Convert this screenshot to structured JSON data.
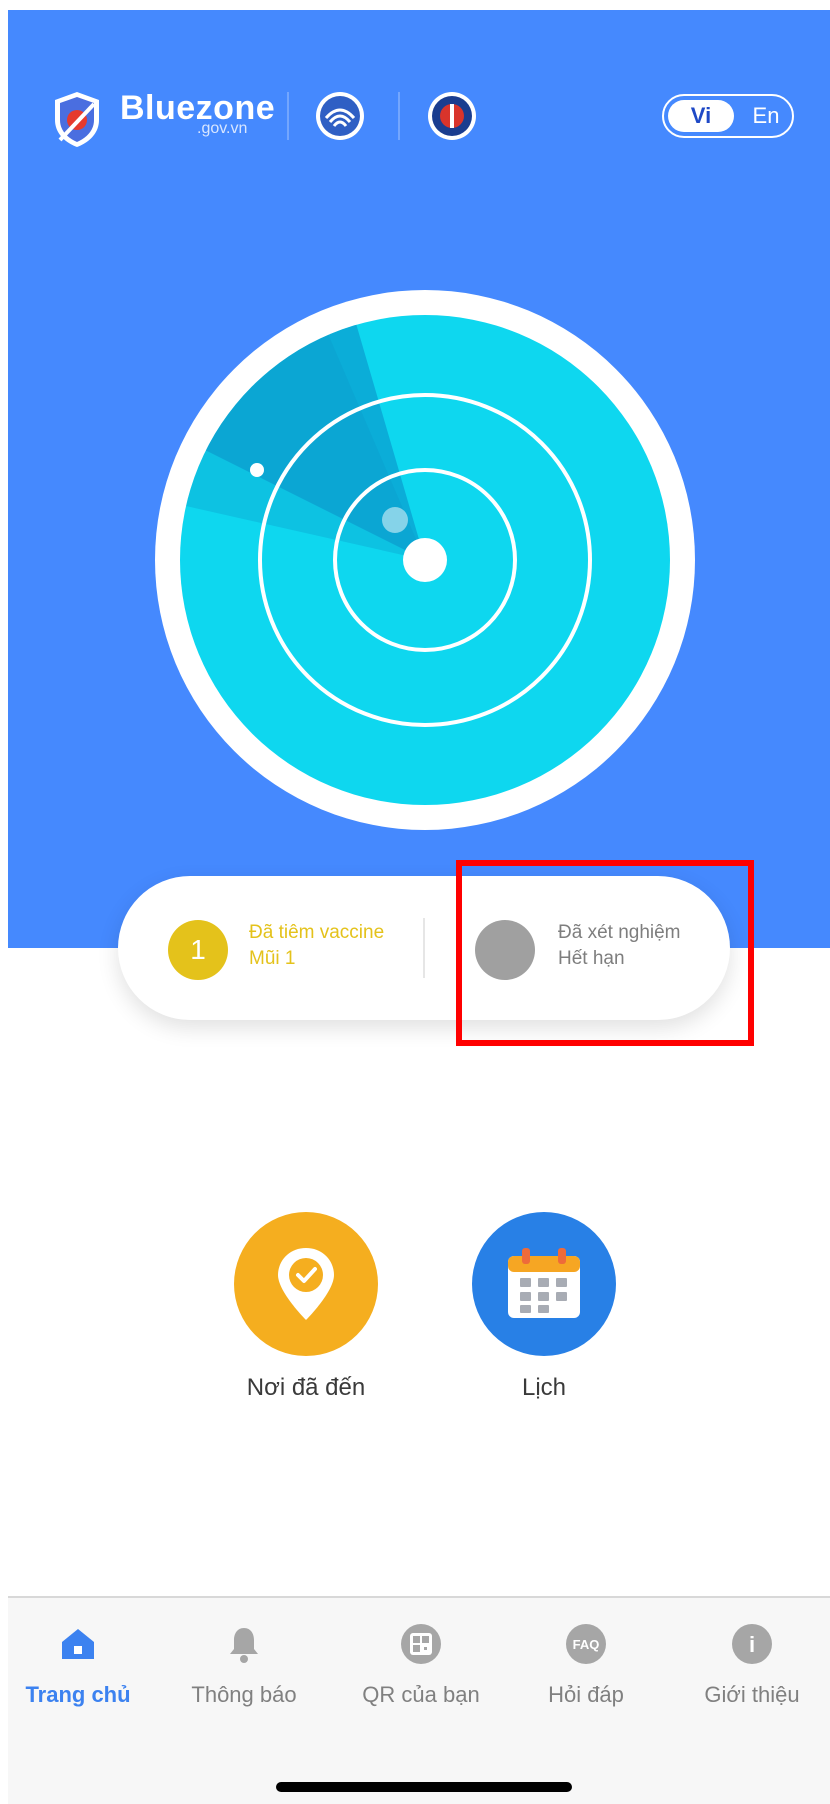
{
  "brand": {
    "name": "Bluezone",
    "domain": ".gov.vn"
  },
  "language": {
    "vi_label": "Vi",
    "en_label": "En",
    "selected": "Vi"
  },
  "status": {
    "vaccine": {
      "dose_number": "1",
      "line1": "Đã tiêm vaccine",
      "line2": "Mũi 1",
      "color": "#e4c21b"
    },
    "test": {
      "line1": "Đã xét nghiệm",
      "line2": "Hết hạn",
      "color": "#a0a0a0"
    }
  },
  "actions": [
    {
      "label": "Nơi đã đến",
      "icon": "location-check-icon",
      "color": "#f5ae1f"
    },
    {
      "label": "Lịch",
      "icon": "calendar-icon",
      "color": "#2880e6"
    }
  ],
  "tabs": [
    {
      "label": "Trang chủ",
      "icon": "home-icon",
      "active": true
    },
    {
      "label": "Thông báo",
      "icon": "bell-icon",
      "active": false
    },
    {
      "label": "QR của bạn",
      "icon": "qr-icon",
      "active": false
    },
    {
      "label": "Hỏi đáp",
      "icon": "faq-icon",
      "icon_text": "FAQ",
      "active": false
    },
    {
      "label": "Giới thiệu",
      "icon": "info-icon",
      "icon_text": "i",
      "active": false
    }
  ],
  "colors": {
    "hero": "#4589fe",
    "radar": "#0ed7ef",
    "accent_active": "#3c82f0"
  }
}
